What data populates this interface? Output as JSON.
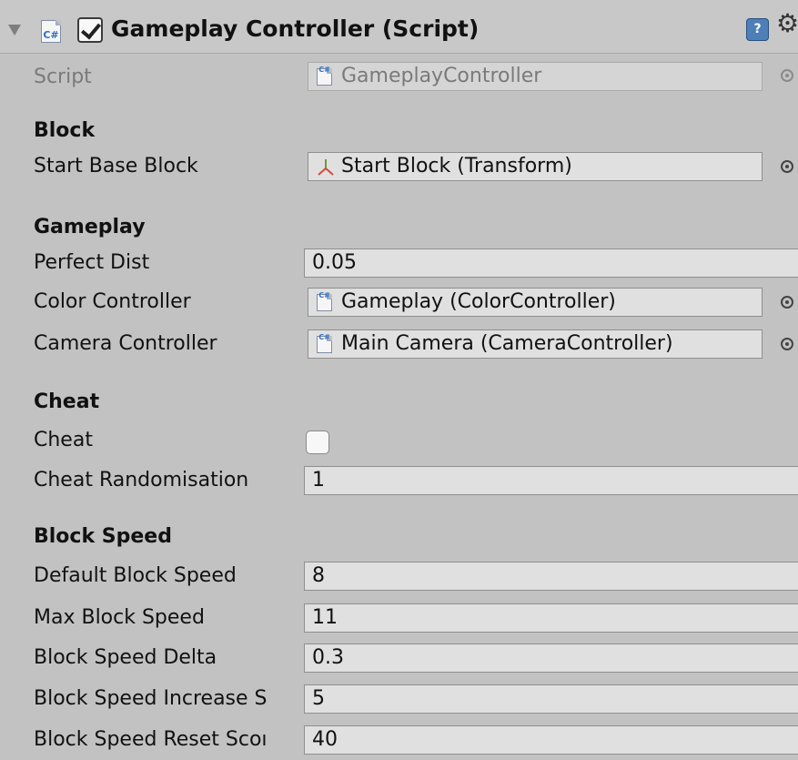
{
  "component": {
    "title": "Gameplay Controller (Script)",
    "enabled": true
  },
  "script_field": {
    "label": "Script",
    "value": "GameplayController"
  },
  "sections": {
    "block": "Block",
    "gameplay": "Gameplay",
    "cheat": "Cheat",
    "block_speed": "Block Speed"
  },
  "fields": {
    "start_base_block": {
      "label": "Start Base Block",
      "value": "Start Block (Transform)"
    },
    "perfect_dist": {
      "label": "Perfect Dist",
      "value": "0.05"
    },
    "color_controller": {
      "label": "Color Controller",
      "value": "Gameplay (ColorController)"
    },
    "camera_controller": {
      "label": "Camera Controller",
      "value": "Main Camera (CameraController)"
    },
    "cheat": {
      "label": "Cheat",
      "checked": false
    },
    "cheat_randomisation": {
      "label": "Cheat Randomisation",
      "value": "1"
    },
    "default_block_speed": {
      "label": "Default Block Speed",
      "value": "8"
    },
    "max_block_speed": {
      "label": "Max Block Speed",
      "value": "11"
    },
    "block_speed_delta": {
      "label": "Block Speed Delta",
      "value": "0.3"
    },
    "block_speed_increase": {
      "label": "Block Speed Increase S",
      "value": "5"
    },
    "block_speed_reset": {
      "label": "Block Speed Reset Scoı",
      "value": "40"
    }
  },
  "icons": {
    "script": "csharp-script-icon",
    "transform": "transform-axes-icon",
    "help": "help-book-icon",
    "settings": "gear-icon",
    "object_picker": "object-picker-icon"
  },
  "colors": {
    "background": "#c2c2c2",
    "field_background": "#e0e0e0",
    "help_icon": "#4d7fb8"
  }
}
